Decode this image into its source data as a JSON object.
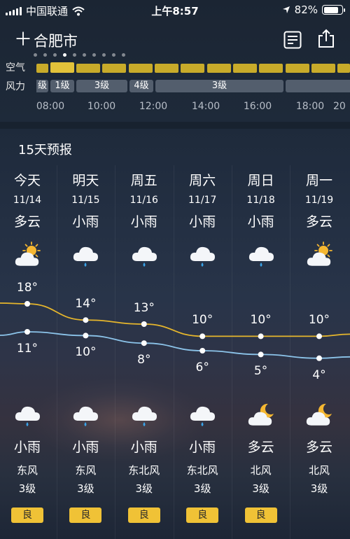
{
  "status_bar": {
    "carrier": "中国联通",
    "time": "上午8:57",
    "battery": "82%",
    "battery_level": 0.82
  },
  "header": {
    "city": "合肥市",
    "page_count": 10,
    "active_page": 3
  },
  "hourly": {
    "air_label": "空气",
    "wind_label": "风力",
    "wind_segments": [
      "级",
      "1级",
      "3级",
      "4级",
      "3级"
    ],
    "hours": [
      "08:00",
      "10:00",
      "12:00",
      "14:00",
      "16:00",
      "18:00",
      "20"
    ]
  },
  "forecast": {
    "title": "15天预报",
    "days": [
      {
        "name": "今天",
        "date": "11/14",
        "day_cond": "多云",
        "day_icon": "partly-cloudy-icon",
        "high": "18°",
        "low": "11°",
        "high_val": 18,
        "low_val": 11,
        "night_cond": "小雨",
        "night_icon": "rain-icon",
        "wind_dir": "东风",
        "wind_level": "3级",
        "aqi": "良"
      },
      {
        "name": "明天",
        "date": "11/15",
        "day_cond": "小雨",
        "day_icon": "rain-icon",
        "high": "14°",
        "low": "10°",
        "high_val": 14,
        "low_val": 10,
        "night_cond": "小雨",
        "night_icon": "rain-icon",
        "wind_dir": "东风",
        "wind_level": "3级",
        "aqi": "良"
      },
      {
        "name": "周五",
        "date": "11/16",
        "day_cond": "小雨",
        "day_icon": "rain-icon",
        "high": "13°",
        "low": "8°",
        "high_val": 13,
        "low_val": 8,
        "night_cond": "小雨",
        "night_icon": "rain-icon",
        "wind_dir": "东北风",
        "wind_level": "3级",
        "aqi": "良"
      },
      {
        "name": "周六",
        "date": "11/17",
        "day_cond": "小雨",
        "day_icon": "rain-icon",
        "high": "10°",
        "low": "6°",
        "high_val": 10,
        "low_val": 6,
        "night_cond": "小雨",
        "night_icon": "rain-icon",
        "wind_dir": "东北风",
        "wind_level": "3级",
        "aqi": "良"
      },
      {
        "name": "周日",
        "date": "11/18",
        "day_cond": "小雨",
        "day_icon": "rain-icon",
        "high": "10°",
        "low": "5°",
        "high_val": 10,
        "low_val": 5,
        "night_cond": "多云",
        "night_icon": "cloudy-night-icon",
        "wind_dir": "北风",
        "wind_level": "3级",
        "aqi": "良"
      },
      {
        "name": "周一",
        "date": "11/19",
        "day_cond": "多云",
        "day_icon": "partly-cloudy-icon",
        "high": "10°",
        "low": "4°",
        "high_val": 10,
        "low_val": 4,
        "night_cond": "多云",
        "night_icon": "cloudy-night-icon",
        "wind_dir": "北风",
        "wind_level": "3级",
        "aqi": ""
      }
    ]
  },
  "colors": {
    "high_line": "#e6b62c",
    "low_line": "#8cc4ea",
    "aqi_good": "#f0c236",
    "air_bar": "#c8ab2a"
  }
}
